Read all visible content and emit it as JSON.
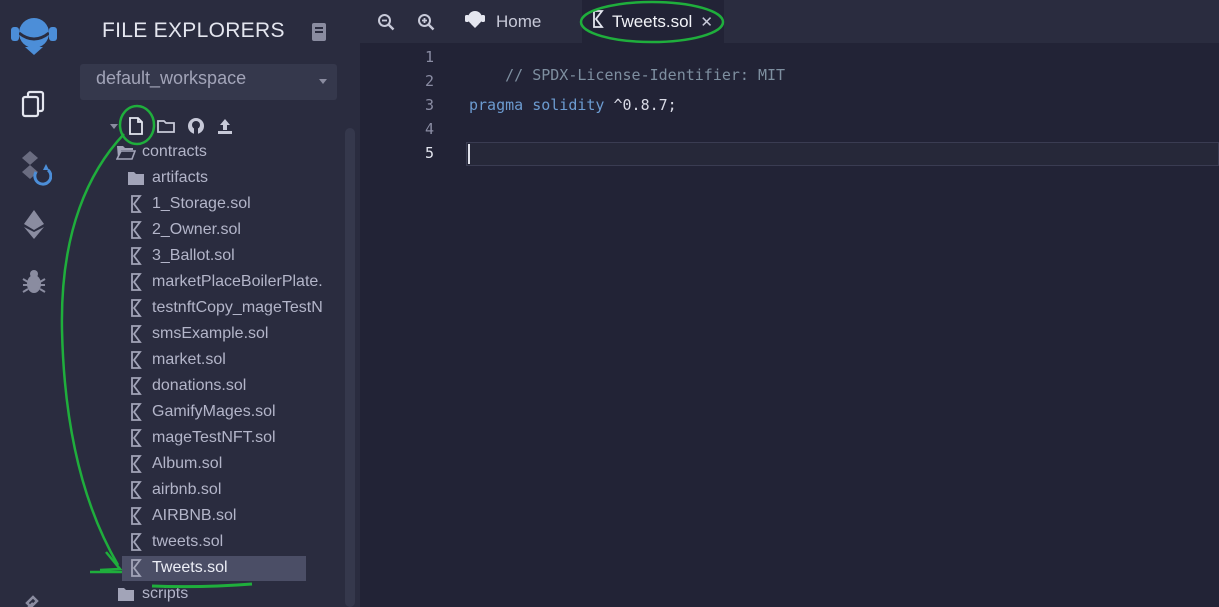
{
  "sidebar_icons": [
    "remix-logo-icon",
    "file-explorer-icon",
    "compiler-icon",
    "deploy-icon",
    "debugger-icon",
    "settings-plug-icon"
  ],
  "panel": {
    "title": "FILE EXPLORERS",
    "workspace": "default_workspace"
  },
  "tree": {
    "contracts_folder": "contracts",
    "items": [
      {
        "label": "artifacts",
        "type": "folder"
      },
      {
        "label": "1_Storage.sol",
        "type": "file"
      },
      {
        "label": "2_Owner.sol",
        "type": "file"
      },
      {
        "label": "3_Ballot.sol",
        "type": "file"
      },
      {
        "label": "marketPlaceBoilerPlate.",
        "type": "file"
      },
      {
        "label": "testnftCopy_mageTestN",
        "type": "file"
      },
      {
        "label": "smsExample.sol",
        "type": "file"
      },
      {
        "label": "market.sol",
        "type": "file"
      },
      {
        "label": "donations.sol",
        "type": "file"
      },
      {
        "label": "GamifyMages.sol",
        "type": "file"
      },
      {
        "label": "mageTestNFT.sol",
        "type": "file"
      },
      {
        "label": "Album.sol",
        "type": "file"
      },
      {
        "label": "airbnb.sol",
        "type": "file"
      },
      {
        "label": "AIRBNB.sol",
        "type": "file"
      },
      {
        "label": "tweets.sol",
        "type": "file"
      },
      {
        "label": "Tweets.sol",
        "type": "file",
        "selected": true
      }
    ],
    "scripts_folder": "scripts"
  },
  "tabs": {
    "home": "Home",
    "active": "Tweets.sol",
    "close": "✕"
  },
  "editor": {
    "line_numbers": [
      "1",
      "2",
      "3",
      "4",
      "5"
    ],
    "comment": "// SPDX-License-Identifier: MIT",
    "pragma_kw": "pragma",
    "solidity_kw": "solidity",
    "version": "^0.8.7;"
  },
  "colors": {
    "background": "#222336",
    "panel": "#2a2c3f",
    "selection": "#4b4e66",
    "annotation": "#1fae3c"
  }
}
